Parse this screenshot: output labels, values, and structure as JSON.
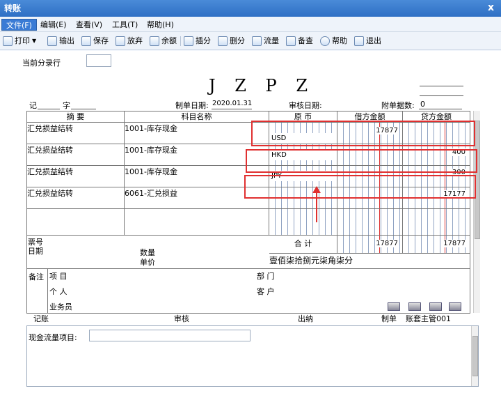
{
  "window": {
    "title": "转账",
    "close": "x"
  },
  "menu": [
    "文件(F)",
    "编辑(E)",
    "查看(V)",
    "工具(T)",
    "帮助(H)"
  ],
  "toolbar": [
    "打印",
    "输出",
    "保存",
    "放弃",
    "余额",
    "插分",
    "删分",
    "流量",
    "备查",
    "帮助",
    "退出"
  ],
  "header": {
    "current_entry_label": "当前分录行",
    "doc_title": "J Z P Z",
    "ji_label": "记",
    "zi_label": "字",
    "date_label": "制单日期:",
    "date_value": "2020.01.31",
    "audit_date_label": "审核日期:",
    "attach_label": "附单据数:",
    "attach_value": "0"
  },
  "table": {
    "headers": {
      "summary": "摘 要",
      "account": "科目名称",
      "currency": "原 币",
      "debit": "借方金额",
      "credit": "贷方金额"
    },
    "rows": [
      {
        "summary": "汇兑损益结转",
        "account": "1001-库存现金",
        "currency": "USD",
        "debit": "17877",
        "credit": ""
      },
      {
        "summary": "汇兑损益结转",
        "account": "1001-库存现金",
        "currency": "HKD",
        "debit": "",
        "credit": "400"
      },
      {
        "summary": "汇兑损益结转",
        "account": "1001-库存现金",
        "currency": "JPY",
        "debit": "",
        "credit": "300"
      },
      {
        "summary": "汇兑损益结转",
        "account": "6061-汇兑损益",
        "currency": "",
        "debit": "",
        "credit": "17177"
      }
    ],
    "ticket_label": "票号",
    "date_label": "日期",
    "qty_label": "数量",
    "unit_label": "单价",
    "total_label": "合 计",
    "total_debit": "17877",
    "total_credit": "17877",
    "total_words": "壹佰柒拾捌元柒角柒分"
  },
  "remarks": {
    "label": "备注",
    "project": "项 目",
    "dept": "部 门",
    "person": "个 人",
    "customer": "客 户",
    "salesman": "业务员"
  },
  "footer": {
    "bookkeeping": "记账",
    "audit": "审核",
    "cashier": "出纳",
    "maker": "制单",
    "maker_value": "账套主管001",
    "cashflow_label": "现金流量项目:"
  }
}
